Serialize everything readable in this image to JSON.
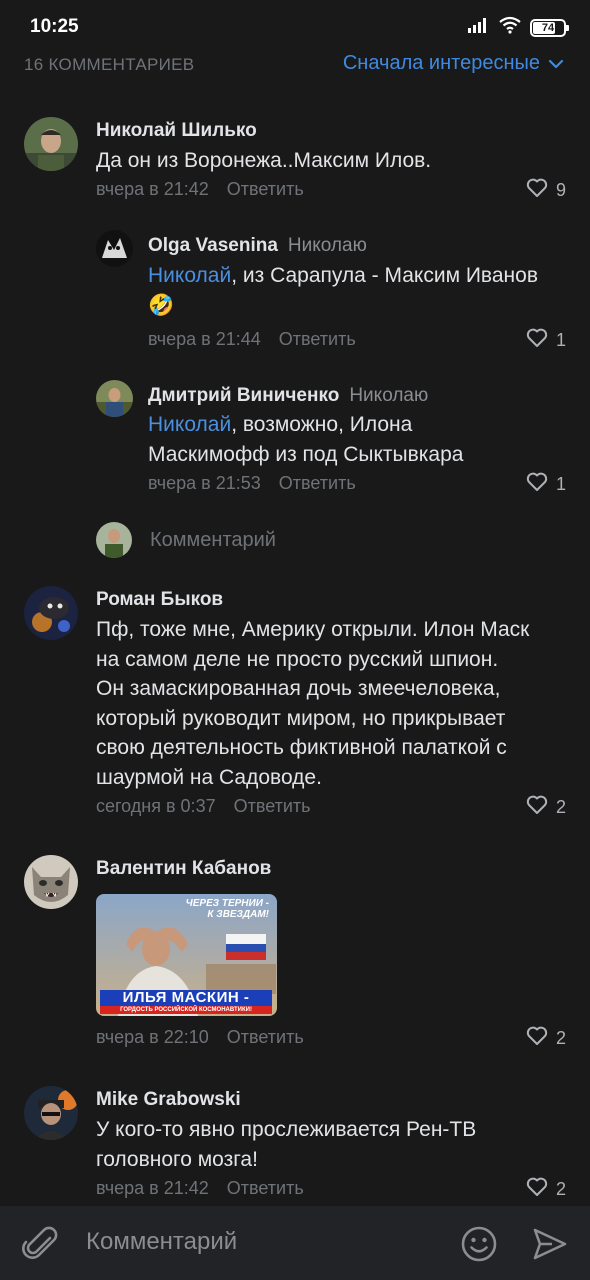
{
  "status": {
    "time": "10:25",
    "battery": "74",
    "battery_level": 0.74
  },
  "header": {
    "count_label": "16 КОММЕНТАРИЕВ",
    "sort_label": "Сначала интересные"
  },
  "comments": [
    {
      "author": "Николай Шилько",
      "text": "Да он из Воронежа..Максим Илов.",
      "time": "вчера в 21:42",
      "reply_label": "Ответить",
      "likes": "9"
    },
    {
      "author": "Olga Vasenina",
      "reply_to": "Николаю",
      "mention": "Николай",
      "text": ", из Сарапула - Максим Иванов",
      "emoji": "🤣",
      "time": "вчера в 21:44",
      "reply_label": "Ответить",
      "likes": "1"
    },
    {
      "author": "Дмитрий Виниченко",
      "reply_to": "Николаю",
      "mention": "Николай",
      "text_line1": ", возможно, Илона",
      "text_line2": "Маскимофф из под Сыктывкара",
      "time": "вчера в 21:53",
      "reply_label": "Ответить",
      "likes": "1"
    },
    {
      "author": "Роман Быков",
      "lines": [
        "Пф, тоже мне, Америку открыли. Илон Маск",
        "на самом деле не просто русский шпион.",
        "Он замаскированная дочь змеечеловека,",
        "который руководит миром, но прикрывает",
        "свою деятельность фиктивной палаткой с",
        "шаурмой на Садоводе."
      ],
      "time": "сегодня в 0:37",
      "reply_label": "Ответить",
      "likes": "2"
    },
    {
      "author": "Валентин Кабанов",
      "image": {
        "caption_top": [
          "ЧЕРЕЗ ТЕРНИИ -",
          "К ЗВЕЗДАМ!"
        ],
        "caption_main": "ИЛЬЯ МАСКИН -",
        "caption_sub": "ГОРДОСТЬ РОССИЙСКОЙ КОСМОНАВТИКИ!"
      },
      "time": "вчера в 22:10",
      "reply_label": "Ответить",
      "likes": "2"
    },
    {
      "author": "Mike Grabowski",
      "lines": [
        "У кого-то явно прослеживается Рен-ТВ",
        "головного мозга!"
      ],
      "time": "вчера в 21:42",
      "reply_label": "Ответить",
      "likes": "2"
    }
  ],
  "inline_composer": {
    "placeholder": "Комментарий"
  },
  "composer": {
    "placeholder": "Комментарий"
  },
  "colors": {
    "accent": "#3f8ae0",
    "background": "#191919",
    "bar": "#222326"
  }
}
